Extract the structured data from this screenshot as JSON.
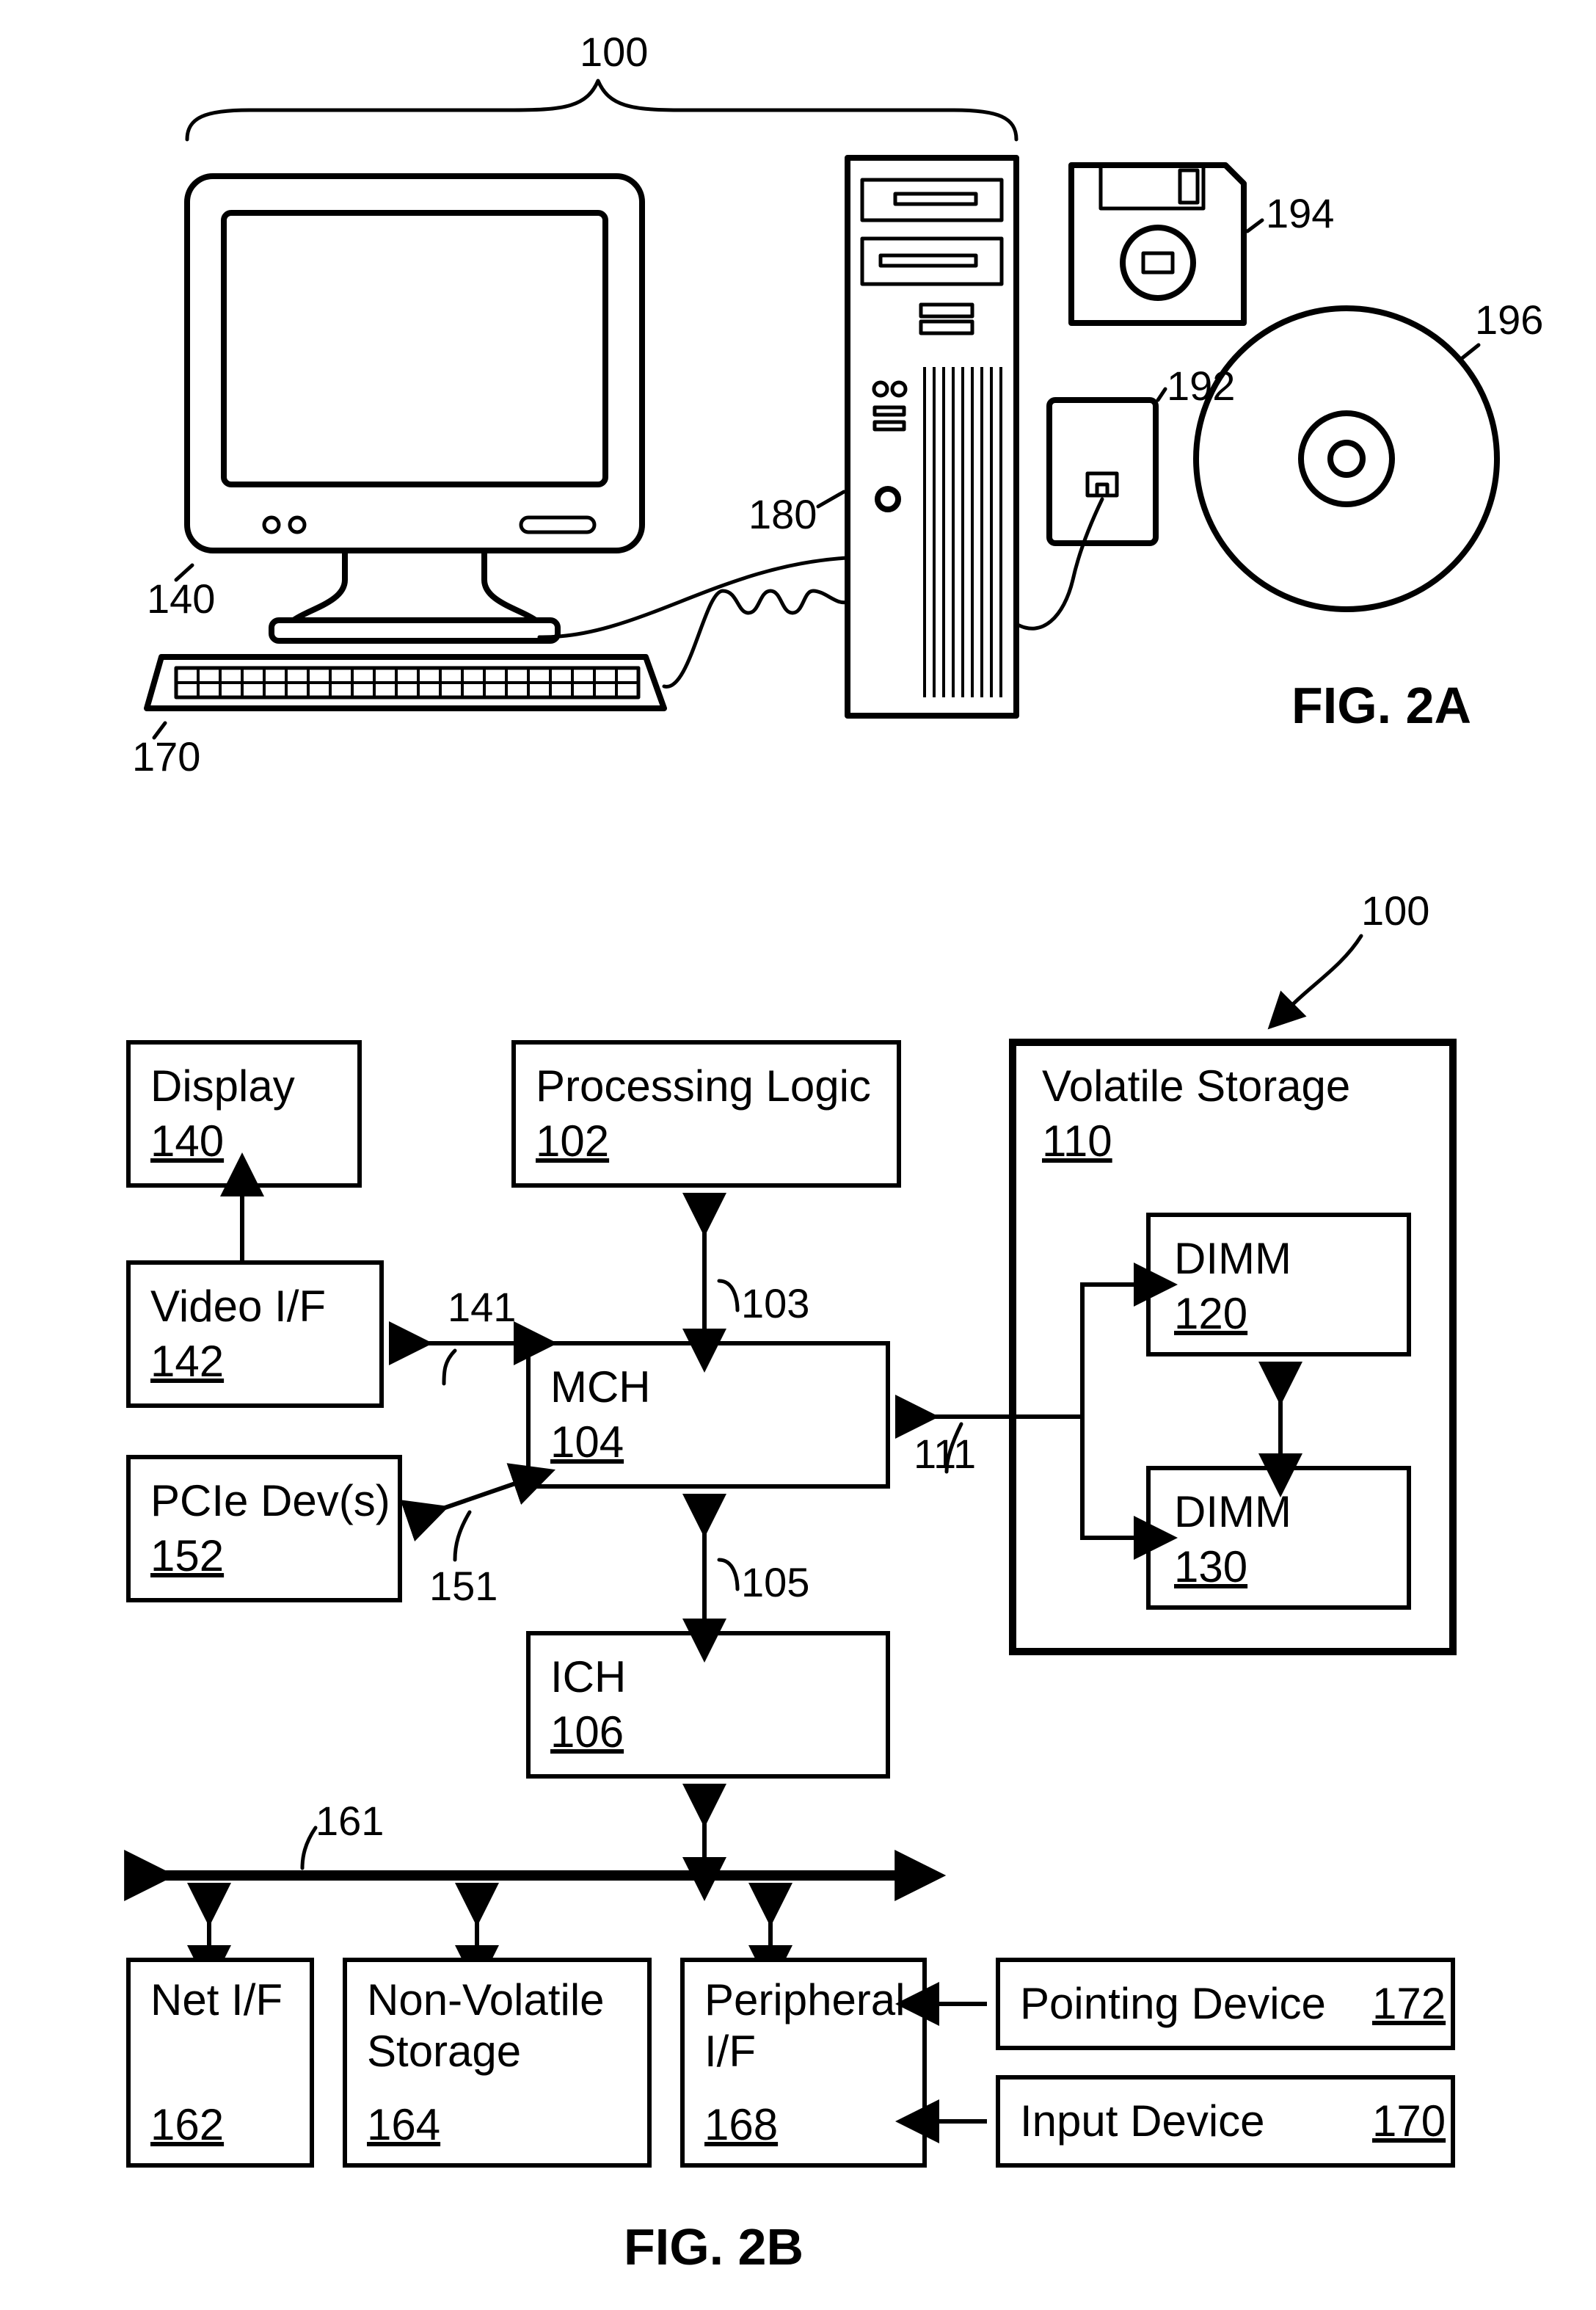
{
  "figA": {
    "system_ref": "100",
    "monitor_ref": "140",
    "keyboard_ref": "170",
    "tower_ref": "180",
    "wall_jack_ref": "192",
    "floppy_ref": "194",
    "cd_ref": "196",
    "title": "FIG. 2A"
  },
  "figB": {
    "system_ref": "100",
    "title": "FIG. 2B",
    "blocks": {
      "display": {
        "label": "Display",
        "ref": "140"
      },
      "video": {
        "label": "Video I/F",
        "ref": "142"
      },
      "pcie": {
        "label": "PCIe Dev(s)",
        "ref": "152"
      },
      "plogic": {
        "label": "Processing Logic",
        "ref": "102"
      },
      "mch": {
        "label": "MCH",
        "ref": "104"
      },
      "ich": {
        "label": "ICH",
        "ref": "106"
      },
      "volstore": {
        "label": "Volatile Storage",
        "ref": "110"
      },
      "dimm0": {
        "label": "DIMM",
        "ref": "120"
      },
      "dimm1": {
        "label": "DIMM",
        "ref": "130"
      },
      "netif": {
        "label": "Net I/F",
        "ref": "162"
      },
      "nvstore": {
        "label": "Non-Volatile Storage",
        "ref": "164"
      },
      "pif": {
        "label": "Peripheral I/F",
        "ref": "168"
      },
      "pointer": {
        "label": "Pointing Device",
        "ref": "172"
      },
      "input": {
        "label": "Input Device",
        "ref": "170"
      }
    },
    "links": {
      "plogic_mch": "103",
      "mch_ich": "105",
      "mch_vol": "111",
      "mch_video": "141",
      "mch_pcie": "151",
      "bus": "161"
    }
  }
}
